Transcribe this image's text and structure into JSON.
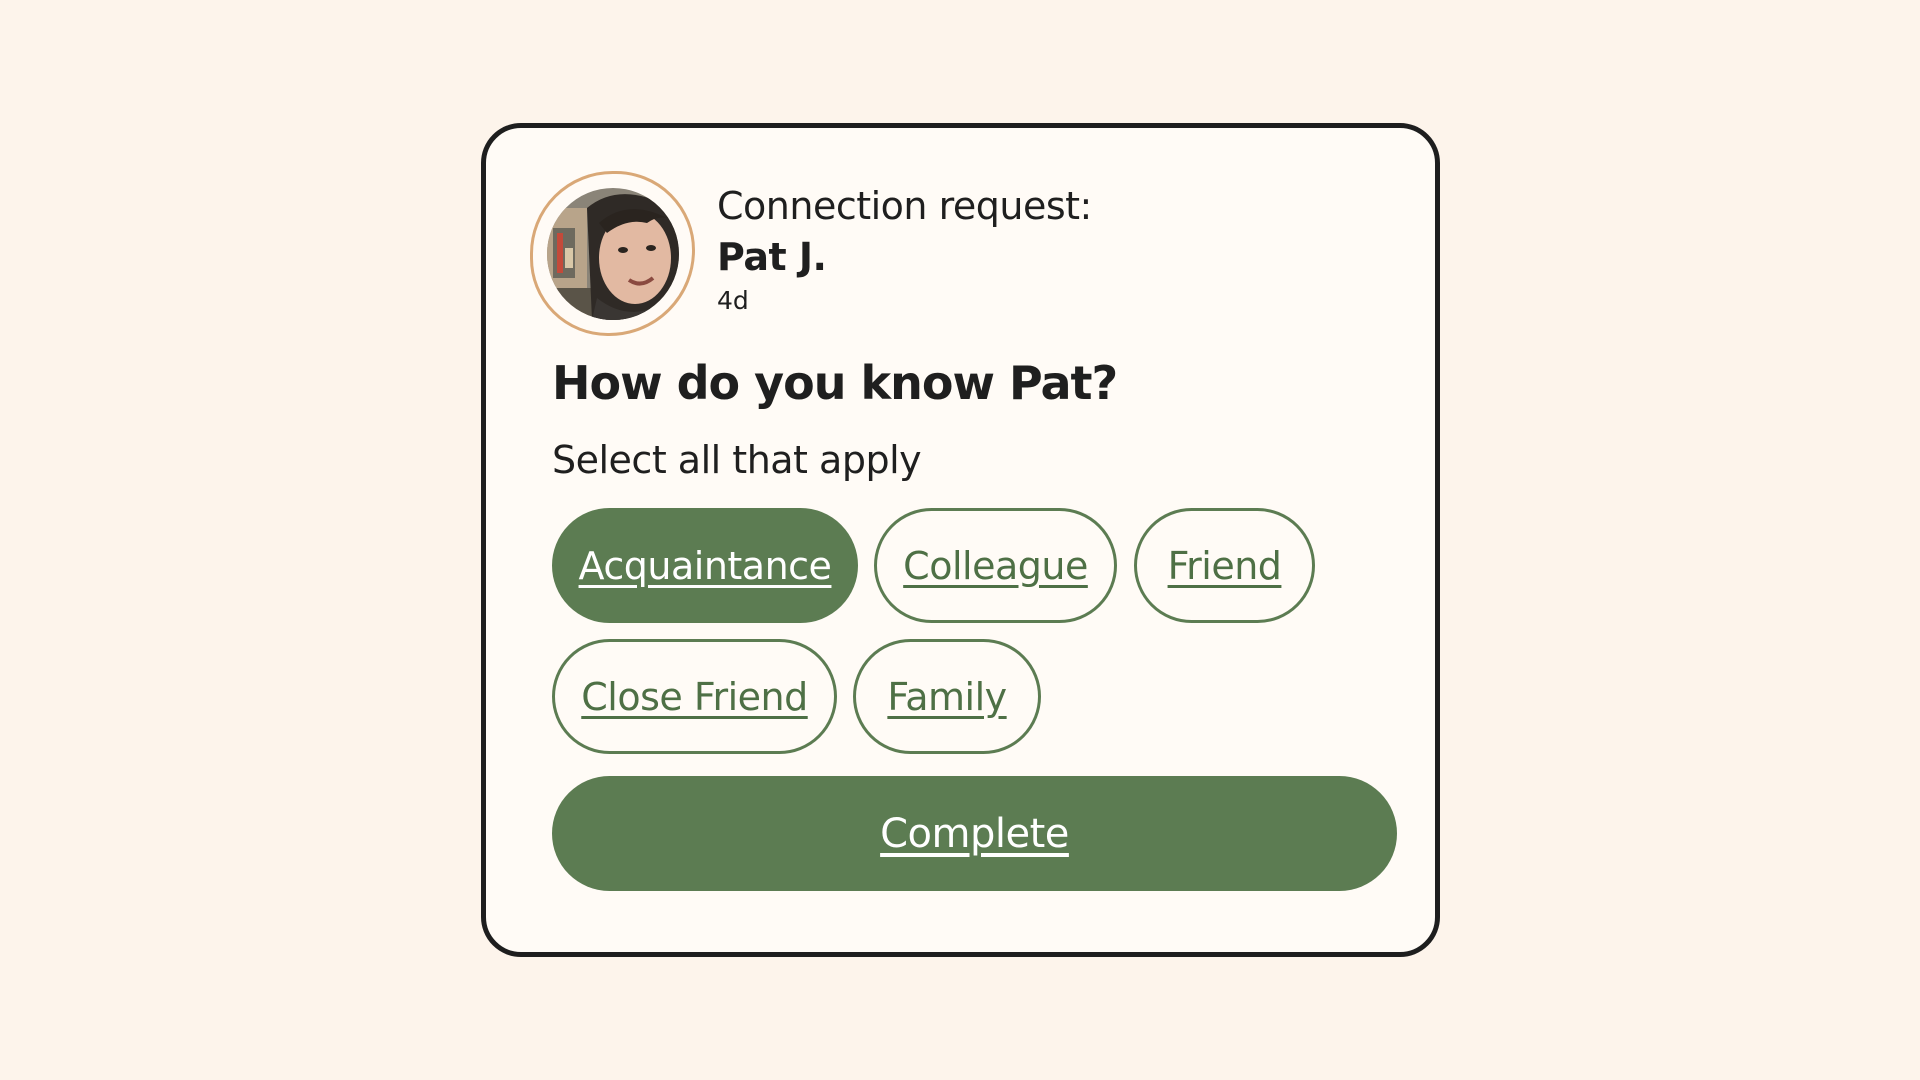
{
  "header": {
    "label": "Connection request:",
    "name": "Pat J.",
    "time": "4d"
  },
  "avatar": {
    "alt": "Profile photo of Pat J."
  },
  "question": "How do you know Pat?",
  "hint": "Select all that apply",
  "options": [
    {
      "label": "Acquaintance",
      "selected": true
    },
    {
      "label": "Colleague",
      "selected": false
    },
    {
      "label": "Friend",
      "selected": false
    },
    {
      "label": "Close Friend",
      "selected": false
    },
    {
      "label": "Family",
      "selected": false
    }
  ],
  "complete_label": "Complete",
  "colors": {
    "background": "#fdf4eb",
    "card": "#fffbf6",
    "accent": "#5c7c52",
    "avatar_ring": "#d9a877"
  }
}
